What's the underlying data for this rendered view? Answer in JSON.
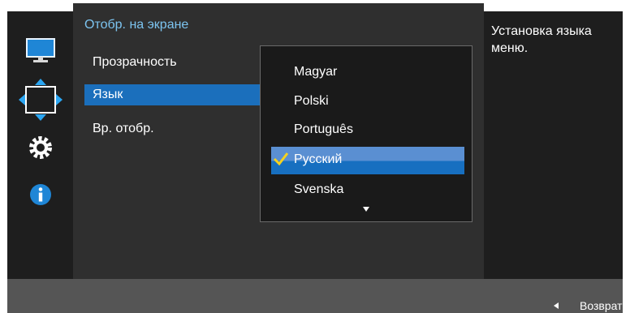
{
  "menu": {
    "title": "Отобр. на экране",
    "items": [
      {
        "label": "Прозрачность"
      },
      {
        "label": "Язык",
        "selected": true
      },
      {
        "label": "Вр. отобр."
      }
    ]
  },
  "language_dropdown": {
    "options": [
      "Magyar",
      "Polski",
      "Português",
      "Русский",
      "Svenska"
    ],
    "selected": "Русский",
    "more_indicator": "chevron-down-icon"
  },
  "sidebar": {
    "icons": [
      "monitor-icon",
      "move-arrows-icon",
      "gear-icon",
      "info-icon"
    ]
  },
  "help": {
    "text": "Установка языка меню."
  },
  "footer": {
    "back_label": "Возврат",
    "back_icon": "left-arrow-icon"
  },
  "colors": {
    "highlight_blue": "#1b6fbc",
    "title_blue": "#7cc4f0",
    "check_yellow": "#f4d21f",
    "panel_dark": "#1e1e1e",
    "panel_main": "#2f2f2f",
    "bottom_bar": "#555555"
  }
}
